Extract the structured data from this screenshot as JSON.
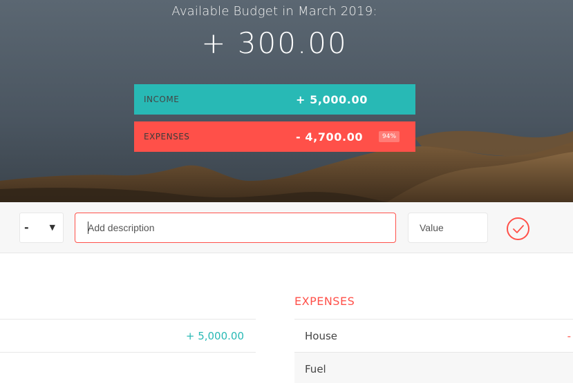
{
  "header": {
    "budget_title": "Available Budget in March 2019:",
    "budget_value": "+ 300.00",
    "income": {
      "label": "INCOME",
      "value": "+ 5,000.00"
    },
    "expenses": {
      "label": "EXPENSES",
      "value": "- 4,700.00",
      "percentage": "94%"
    }
  },
  "add_bar": {
    "type_selected": "-",
    "description_placeholder": "Add description",
    "value_placeholder": "Value"
  },
  "lists": {
    "income_items": [
      {
        "value": "+ 5,000.00"
      }
    ],
    "expenses_title": "EXPENSES",
    "expense_items": [
      {
        "description": "House",
        "value": "-"
      },
      {
        "description": "Fuel"
      }
    ]
  },
  "colors": {
    "income": "#28b9b5",
    "expense": "#ff5049"
  },
  "icons": {
    "type_select": "chevron-down-icon",
    "add_button": "checkmark-icon"
  }
}
